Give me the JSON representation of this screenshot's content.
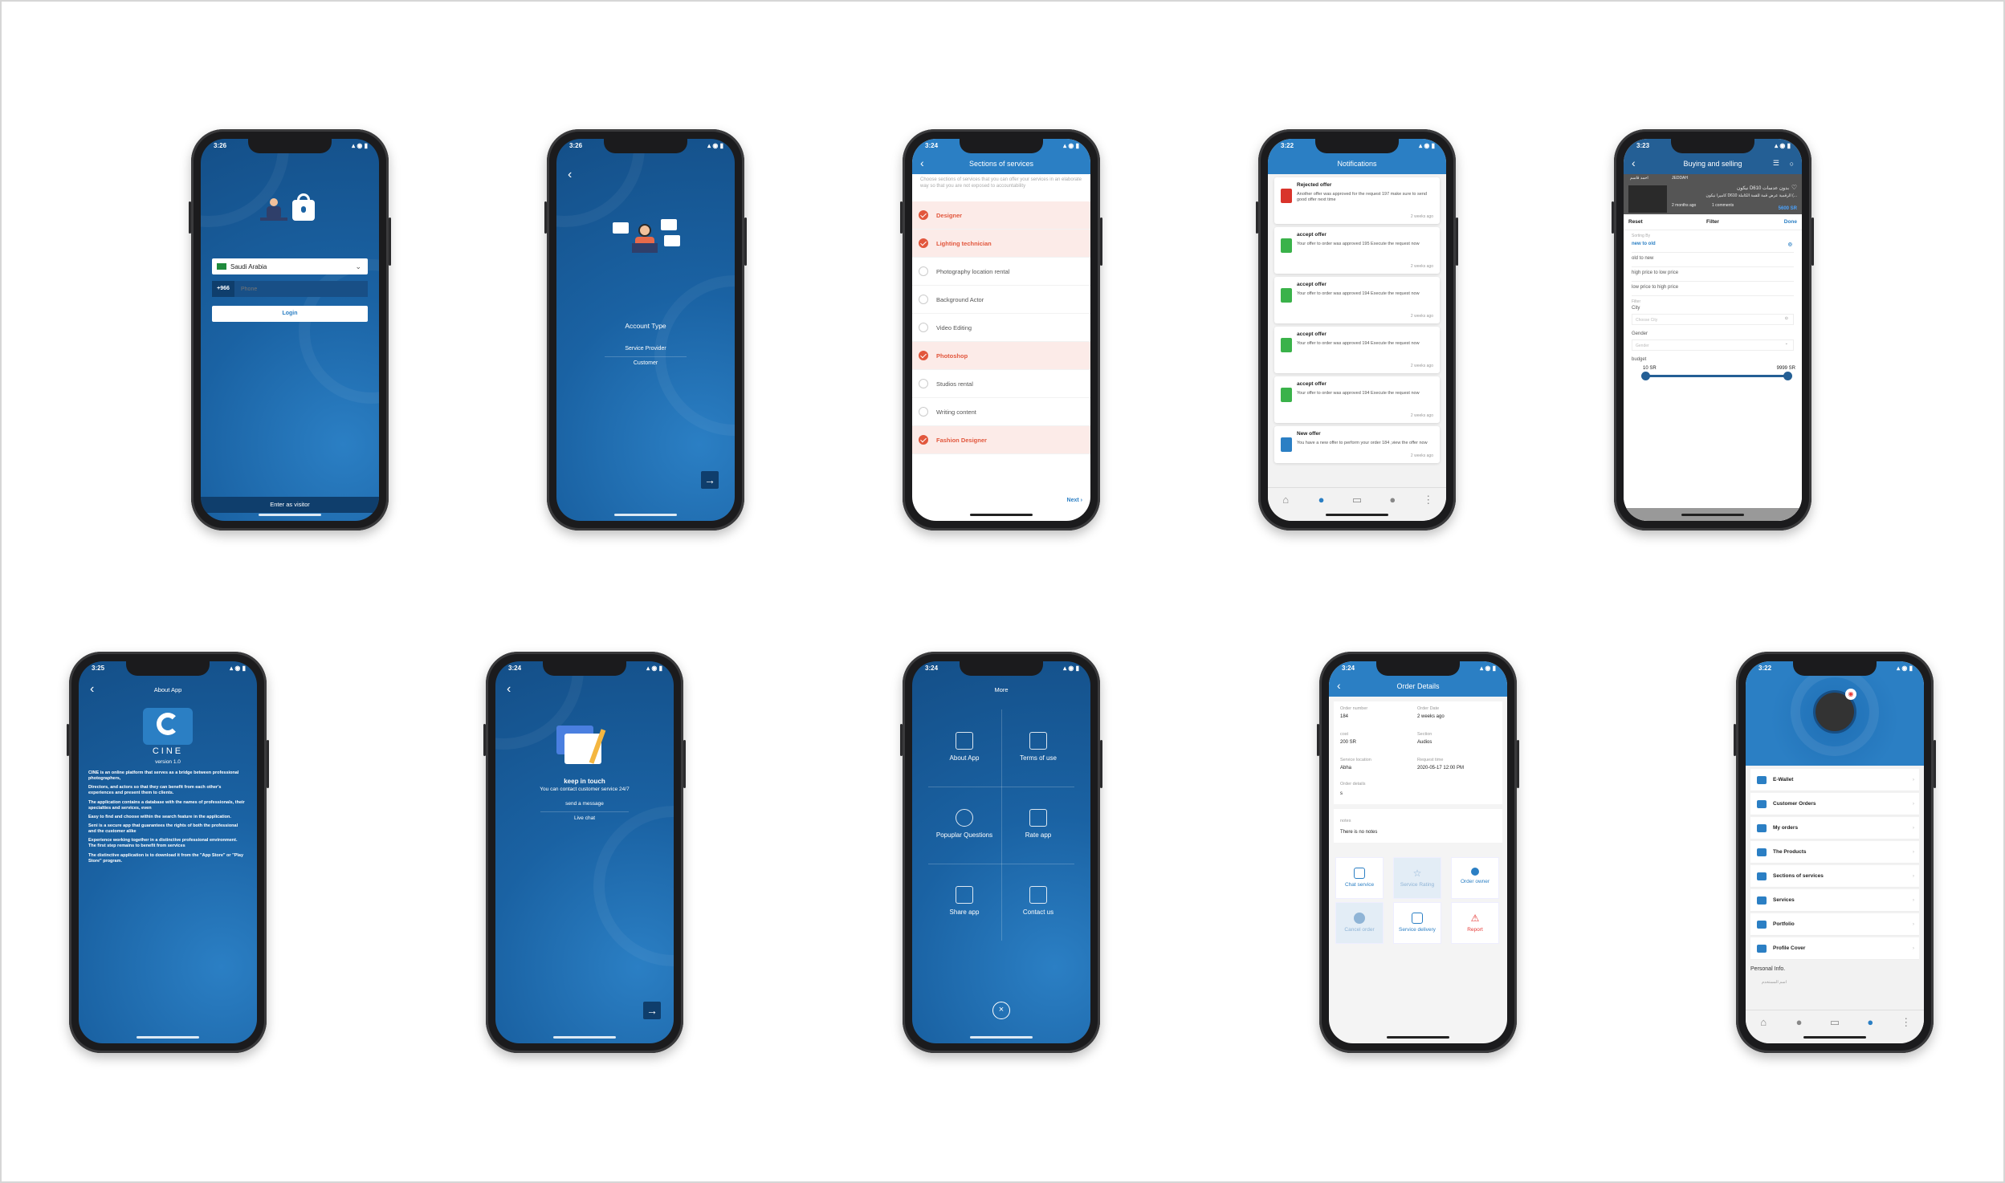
{
  "colors": {
    "primary": "#1a62a3",
    "accent": "#2b7fc4",
    "selected": "#e2573d",
    "doc_red": "#d9342b",
    "doc_green": "#3ab24a"
  },
  "login": {
    "time": "3:26",
    "country": "Saudi Arabia",
    "code": "+966",
    "phone_placeholder": "Phone",
    "login_label": "Login",
    "visitor_label": "Enter as visitor"
  },
  "account": {
    "time": "3:26",
    "title": "Account Type",
    "options": [
      "Service Provider",
      "Customer"
    ]
  },
  "sections": {
    "time": "3:24",
    "title": "Sections of services",
    "hint": "Choose sections of services that you can offer your services in an elaborate way so that you are not exposed to accountability",
    "items": [
      {
        "label": "Designer",
        "selected": true
      },
      {
        "label": "Lighting technician",
        "selected": true
      },
      {
        "label": "Photography location rental",
        "selected": false
      },
      {
        "label": "Background Actor",
        "selected": false
      },
      {
        "label": "Video Editing",
        "selected": false
      },
      {
        "label": "Photoshop",
        "selected": true
      },
      {
        "label": "Studios rental",
        "selected": false
      },
      {
        "label": "Writing content",
        "selected": false
      },
      {
        "label": "Fashion Designer",
        "selected": true
      }
    ],
    "next_label": "Next"
  },
  "notifications": {
    "time": "3:22",
    "title": "Notifications",
    "items": [
      {
        "title": "Rejected offer",
        "body": "Another offer was approved for the request 197 make sure to send good offer next time",
        "date": "2 weeks ago",
        "kind": "red"
      },
      {
        "title": "accept offer",
        "body": "Your offer to order was approved 195 Execute the request now",
        "date": "2 weeks ago",
        "kind": "green"
      },
      {
        "title": "accept offer",
        "body": "Your offer to order was approved 194 Execute the request now",
        "date": "2 weeks ago",
        "kind": "green"
      },
      {
        "title": "accept offer",
        "body": "Your offer to order was approved 194 Execute the request now",
        "date": "2 weeks ago",
        "kind": "green"
      },
      {
        "title": "accept offer",
        "body": "Your offer to order was approved 194 Execute the request now",
        "date": "2 weeks ago",
        "kind": "green"
      },
      {
        "title": "New offer",
        "body": "You have a new offer to perform your order 184 ,view the offer now",
        "date": "2 weeks ago",
        "kind": "blue"
      }
    ]
  },
  "filter": {
    "time": "3:23",
    "title": "Buying and selling",
    "seller": "احمد قاسم",
    "city_top": "JEDDAH",
    "product_title": "نيكون D610 بدون عدسات",
    "product_sub": "كاميرا نيكون D610 الرقمية عرض قمة للقمة الكاملة (...",
    "product_time": "2 months ago",
    "product_comments": "1 comments",
    "product_price": "5600 SR",
    "reset": "Reset",
    "heading": "Filter",
    "done": "Done",
    "sort_label": "Sorting By",
    "sort_options": [
      "new to old",
      "old to new",
      "high price to low price",
      "low price to high price"
    ],
    "filter_label": "Filter",
    "city_label": "City",
    "city_placeholder": "Choose City",
    "gender_label": "Gender",
    "gender_placeholder": "Gender",
    "budget_label": "budget",
    "budget_min": "10 SR",
    "budget_max": "9999 SR"
  },
  "about": {
    "time": "3:25",
    "title": "About App",
    "brand": "CINE",
    "version": "version 1.0",
    "paragraphs": [
      "CINE is an online platform that serves as a bridge between professional photographers,",
      "Directors, and actors so that they can benefit from each other's experiences and present them to clients.",
      "The application contains a database with the names of professionals, their specialties and services, even",
      "Easy to find and choose within the search feature in the application.",
      "Seni is a secure app that guarantees the rights of both the professional and the customer alike",
      "Experience working together in a distinctive professional environment. The first step remains to benefit from services",
      "The distinctive application is to download it from the \"App Store\" or \"Play Store\" program."
    ]
  },
  "touch": {
    "time": "3:24",
    "title": "keep in touch",
    "subtitle": "You can contact customer service 24/7",
    "options": [
      "send a message",
      "Live chat"
    ]
  },
  "more": {
    "time": "3:24",
    "title": "More",
    "items": [
      "About App",
      "Terms of use",
      "Popuplar Questions",
      "Rate app",
      "Share app",
      "Contact us"
    ]
  },
  "order": {
    "time": "3:24",
    "title": "Order Details",
    "fields": [
      {
        "label": "Order number",
        "value": "184"
      },
      {
        "label": "Order Date",
        "value": "2 weeks ago"
      },
      {
        "label": "cost",
        "value": "200 SR"
      },
      {
        "label": "Section",
        "value": "Audios"
      },
      {
        "label": "Service location",
        "value": "Abha"
      },
      {
        "label": "Request time",
        "value": "2020-05-17 12:00 PM"
      },
      {
        "label": "Order details",
        "value": "s"
      },
      {
        "label": "notes",
        "value": "There is no notes"
      }
    ],
    "actions": [
      "Chat service",
      "Service Rating",
      "Order owner",
      "Cancel order",
      "Service delivery",
      "Report"
    ]
  },
  "profile": {
    "time": "3:22",
    "items": [
      "E-Wallet",
      "Customer Orders",
      "My orders",
      "The Products",
      "Sections of services",
      "Services",
      "Portfolio",
      "Profile Cover"
    ],
    "personal_label": "Personal Info.",
    "name_label": "اسم المستخدم"
  }
}
